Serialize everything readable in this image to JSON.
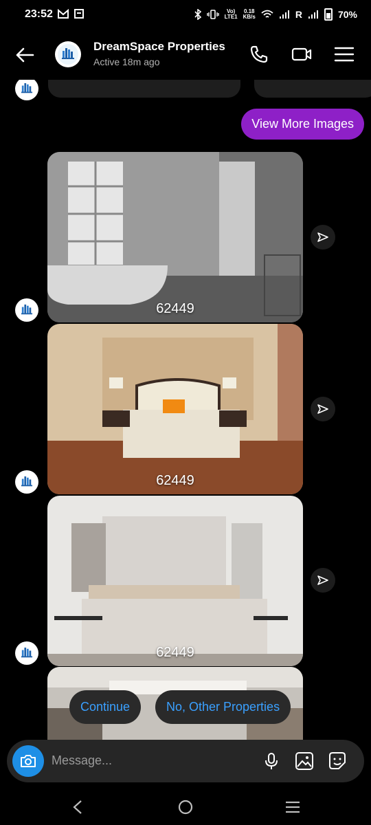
{
  "status_bar": {
    "time": "23:52",
    "net_speed_top": "0.18",
    "net_speed_bottom": "KB/s",
    "volte_top": "Vo)",
    "volte_bottom": "LTE1",
    "carrier_r": "R",
    "battery": "70%"
  },
  "header": {
    "name": "DreamSpace Properties",
    "status": "Active 18m ago"
  },
  "messages": {
    "view_more": "View More Images",
    "images": [
      {
        "label": "62449",
        "scene": "bathroom"
      },
      {
        "label": "62449",
        "scene": "bedroom-warm"
      },
      {
        "label": "62449",
        "scene": "bedroom-grey"
      },
      {
        "label": "",
        "scene": "room-partial"
      }
    ]
  },
  "quick_replies": {
    "continue": "Continue",
    "other": "No, Other Properties"
  },
  "input": {
    "placeholder": "Message..."
  },
  "icons": {
    "back": "arrow-left-icon",
    "call": "phone-icon",
    "video": "video-camera-icon",
    "menu": "menu-icon",
    "share": "send-icon",
    "camera": "camera-icon",
    "mic": "microphone-icon",
    "gallery": "image-icon",
    "sticker": "sticker-icon"
  },
  "colors": {
    "accent_purple": "#8e20c7",
    "camera_blue": "#1e8fe6",
    "link_blue": "#3aa0ff"
  }
}
